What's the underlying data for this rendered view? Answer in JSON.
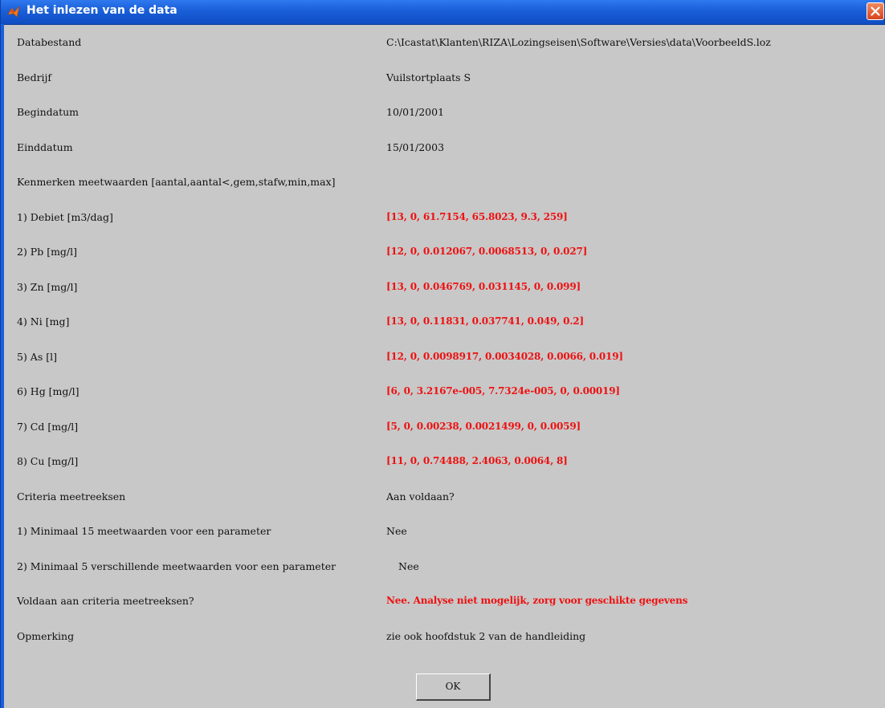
{
  "window": {
    "title": "Het inlezen van de data",
    "app_icon": "matlab-icon",
    "close_icon": "close-icon"
  },
  "rows": [
    {
      "label": "Databestand",
      "value": "C:\\Icastat\\Klanten\\RIZA\\Lozingseisen\\Software\\Versies\\data\\VoorbeeldS.loz",
      "red": false
    },
    {
      "label": "Bedrijf",
      "value": "Vuilstortplaats S",
      "red": false
    },
    {
      "label": "Begindatum",
      "value": "10/01/2001",
      "red": false
    },
    {
      "label": "Einddatum",
      "value": "15/01/2003",
      "red": false
    },
    {
      "label": "Kenmerken meetwaarden [aantal,aantal<,gem,stafw,min,max]",
      "value": "",
      "red": false
    },
    {
      "label": "1) Debiet [m3/dag]",
      "value": "[13, 0, 61.7154, 65.8023, 9.3, 259]",
      "red": true
    },
    {
      "label": "2) Pb [mg/l]",
      "value": "[12, 0, 0.012067, 0.0068513, 0, 0.027]",
      "red": true
    },
    {
      "label": "3) Zn [mg/l]",
      "value": "[13, 0, 0.046769, 0.031145, 0, 0.099]",
      "red": true
    },
    {
      "label": "4) Ni [mg]",
      "value": "[13, 0, 0.11831, 0.037741, 0.049, 0.2]",
      "red": true
    },
    {
      "label": "5) As [l]",
      "value": "[12, 0, 0.0098917, 0.0034028, 0.0066, 0.019]",
      "red": true
    },
    {
      "label": "6) Hg [mg/l]",
      "value": "[6, 0, 3.2167e-005, 7.7324e-005, 0, 0.00019]",
      "red": true
    },
    {
      "label": "7) Cd [mg/l]",
      "value": "[5, 0, 0.00238, 0.0021499, 0, 0.0059]",
      "red": true
    },
    {
      "label": "8) Cu [mg/l]",
      "value": "[11, 0, 0.74488, 2.4063, 0.0064, 8]",
      "red": true
    },
    {
      "label": "Criteria meetreeksen",
      "value": "Aan voldaan?",
      "red": false
    },
    {
      "label": "1) Minimaal 15 meetwaarden voor een parameter",
      "value": "Nee",
      "red": false
    },
    {
      "label": "2) Minimaal 5 verschillende meetwaarden voor een parameter",
      "value": "Nee",
      "red": false,
      "shifted": true
    },
    {
      "label": "Voldaan aan criteria meetreeksen?",
      "value": "Nee. Analyse niet mogelijk, zorg voor geschikte gegevens",
      "red": true
    },
    {
      "label": "Opmerking",
      "value": "zie ook hoofdstuk 2 van de handleiding",
      "red": false
    }
  ],
  "buttons": {
    "ok_label": "OK"
  },
  "colors": {
    "titlebar": "#1a5fd8",
    "background": "#c8c8c8",
    "highlight_text": "#ee1111"
  }
}
